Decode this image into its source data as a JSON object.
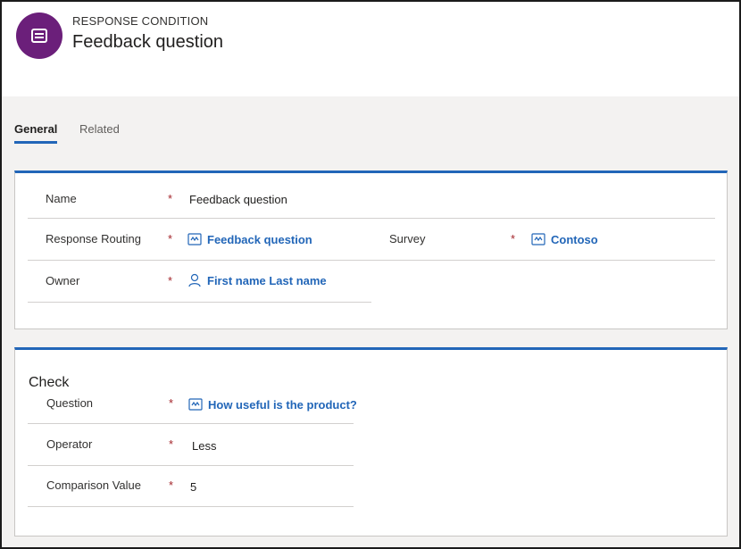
{
  "header": {
    "entity_type": "RESPONSE CONDITION",
    "title": "Feedback question",
    "icon": "condition-entity-icon"
  },
  "tabs": [
    {
      "label": "General",
      "selected": true
    },
    {
      "label": "Related",
      "selected": false
    }
  ],
  "general_section": {
    "name": {
      "label": "Name",
      "required": "*",
      "value": "Feedback question"
    },
    "response_routing": {
      "label": "Response Routing",
      "required": "*",
      "value": "Feedback question",
      "icon": "lookup-entity-icon"
    },
    "survey": {
      "label": "Survey",
      "required": "*",
      "value": "Contoso",
      "icon": "lookup-entity-icon"
    },
    "owner": {
      "label": "Owner",
      "required": "*",
      "value": "First name Last name",
      "icon": "person-icon"
    }
  },
  "check_section": {
    "title": "Check",
    "question": {
      "label": "Question",
      "required": "*",
      "value": "How useful is the product?",
      "icon": "lookup-entity-icon"
    },
    "operator": {
      "label": "Operator",
      "required": "*",
      "value": "Less"
    },
    "comparison_value": {
      "label": "Comparison Value",
      "required": "*",
      "value": "5"
    }
  },
  "colors": {
    "accent": "#2266b8",
    "avatar": "#6b1f7a",
    "required": "#a4262c"
  }
}
